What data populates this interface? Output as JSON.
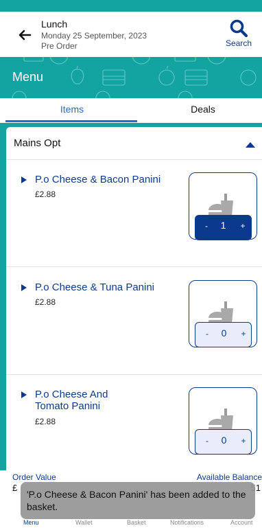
{
  "colors": {
    "brand_teal": "#13a3a1",
    "brand_navy": "#0b3a8c",
    "tab_active": "#2a6ac8"
  },
  "header": {
    "title": "Lunch",
    "date": "Monday 25 September, 2023",
    "order_type": "Pre Order",
    "back_icon": "arrow-left-icon",
    "search_label": "Search",
    "search_icon": "search-icon"
  },
  "menu_banner": {
    "title": "Menu"
  },
  "tabs": [
    {
      "label": "Items",
      "selected": true
    },
    {
      "label": "Deals",
      "selected": false
    }
  ],
  "section": {
    "title": "Mains Opt",
    "expanded": true,
    "toggle_icon": "chevron-up-icon"
  },
  "items": [
    {
      "name_lines": [
        "P.o Cheese & Bacon Panini"
      ],
      "price": "£2.88",
      "quantity": "1",
      "minus": "-",
      "plus": "+",
      "image_icon": "burger-drink-icon"
    },
    {
      "name_lines": [
        "P.o Cheese & Tuna Panini"
      ],
      "price": "£2.88",
      "quantity": "0",
      "minus": "-",
      "plus": "+",
      "image_icon": "burger-drink-icon"
    },
    {
      "name_lines": [
        "P.o Cheese And",
        "Tomato  Panini"
      ],
      "price": "£2.88",
      "quantity": "0",
      "minus": "-",
      "plus": "+",
      "image_icon": "burger-drink-icon"
    }
  ],
  "footer": {
    "order_value_label": "Order Value",
    "order_value_partial": "£",
    "available_balance_label": "Available Balance",
    "available_balance_partial": "51"
  },
  "nav": [
    {
      "label": "Menu",
      "active": true
    },
    {
      "label": "Wallet",
      "active": false
    },
    {
      "label": "Basket",
      "active": false
    },
    {
      "label": "Notifications",
      "active": false
    },
    {
      "label": "Account",
      "active": false
    }
  ],
  "toast": {
    "message": "'P.o Cheese & Bacon Panini' has been added to the basket."
  }
}
